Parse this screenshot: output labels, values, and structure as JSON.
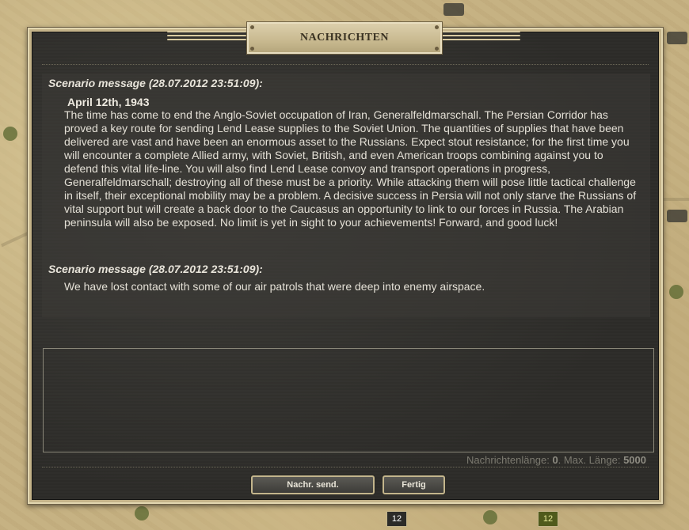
{
  "dialog": {
    "title": "NACHRICHTEN"
  },
  "messages": [
    {
      "header": "Scenario message (28.07.2012 23:51:09):",
      "title": "April 12th, 1943",
      "body": "The time has come to end the Anglo-Soviet occupation of Iran, Generalfeldmarschall. The Persian Corridor has proved a key route for sending Lend Lease supplies to the Soviet Union.  The quantities of supplies that have been delivered are vast and have been an enormous asset to the Russians. Expect stout resistance; for the first time you will encounter a complete Allied army, with Soviet, British, and even American troops combining against you to defend this vital life-line. You will also find Lend Lease convoy and transport operations in progress, Generalfeldmarschall; destroying all of these must be a priority. While attacking them will pose little tactical challenge in itself, their exceptional mobility may be a problem. A decisive success in Persia will not only starve the Russians of vital support but will create a back door to the Caucasus an opportunity to link to our forces in Russia. The Arabian peninsula will also be exposed. No limit is yet in sight to your achievements! Forward, and good luck!"
    },
    {
      "header": "Scenario message (28.07.2012 23:51:09):",
      "body": "We have lost contact with some of our air patrols that were deep into enemy airspace."
    }
  ],
  "compose": {
    "value": "",
    "length_label": "Nachrichtenlänge:",
    "length_value": "0",
    "max_label": ". Max. Länge:",
    "max_value": "5000"
  },
  "buttons": {
    "send": "Nachr. send.",
    "done": "Fertig"
  },
  "map_badges": {
    "left": "12",
    "right": "12"
  }
}
